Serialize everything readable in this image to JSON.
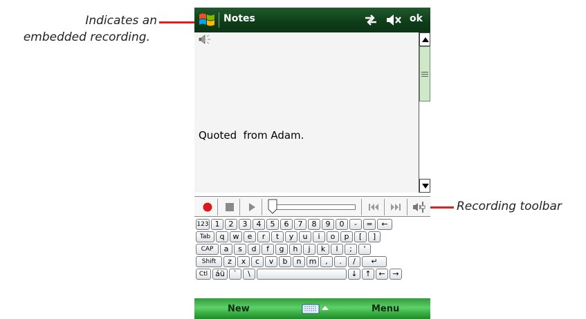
{
  "callouts": {
    "left_line1": "Indicates an",
    "left_line2": "embedded recording.",
    "right": "Recording toolbar"
  },
  "titlebar": {
    "title": "Notes",
    "ok_label": "ok",
    "icons": [
      "windows-start-icon",
      "connectivity-icon",
      "volume-muted-icon"
    ]
  },
  "note": {
    "text": "Quoted  from Adam.",
    "icons": [
      "recording-icon"
    ]
  },
  "recording_toolbar": {
    "buttons": [
      "record",
      "stop",
      "play",
      "position-slider",
      "previous",
      "next",
      "speaker-volume"
    ]
  },
  "keyboard": {
    "row1": [
      "123",
      "1",
      "2",
      "3",
      "4",
      "5",
      "6",
      "7",
      "8",
      "9",
      "0",
      "-",
      "=",
      "←"
    ],
    "row2": [
      "Tab",
      "q",
      "w",
      "e",
      "r",
      "t",
      "y",
      "u",
      "i",
      "o",
      "p",
      "[",
      "]"
    ],
    "row3": [
      "CAP",
      "a",
      "s",
      "d",
      "f",
      "g",
      "h",
      "j",
      "k",
      "l",
      ";",
      "'"
    ],
    "row4": [
      "Shift",
      "z",
      "x",
      "c",
      "v",
      "b",
      "n",
      "m",
      ",",
      ".",
      "/",
      "↵"
    ],
    "row5": [
      "Ctl",
      "áü",
      "`",
      "\\",
      "",
      "↓",
      "↑",
      "←",
      "→"
    ]
  },
  "softkeys": {
    "left": "New",
    "right": "Menu"
  },
  "colors": {
    "title_bar": "#0e3d18",
    "softkey_bar": "#3bb045",
    "callout_line": "#e11d1d",
    "record_button": "#d81b1b"
  }
}
